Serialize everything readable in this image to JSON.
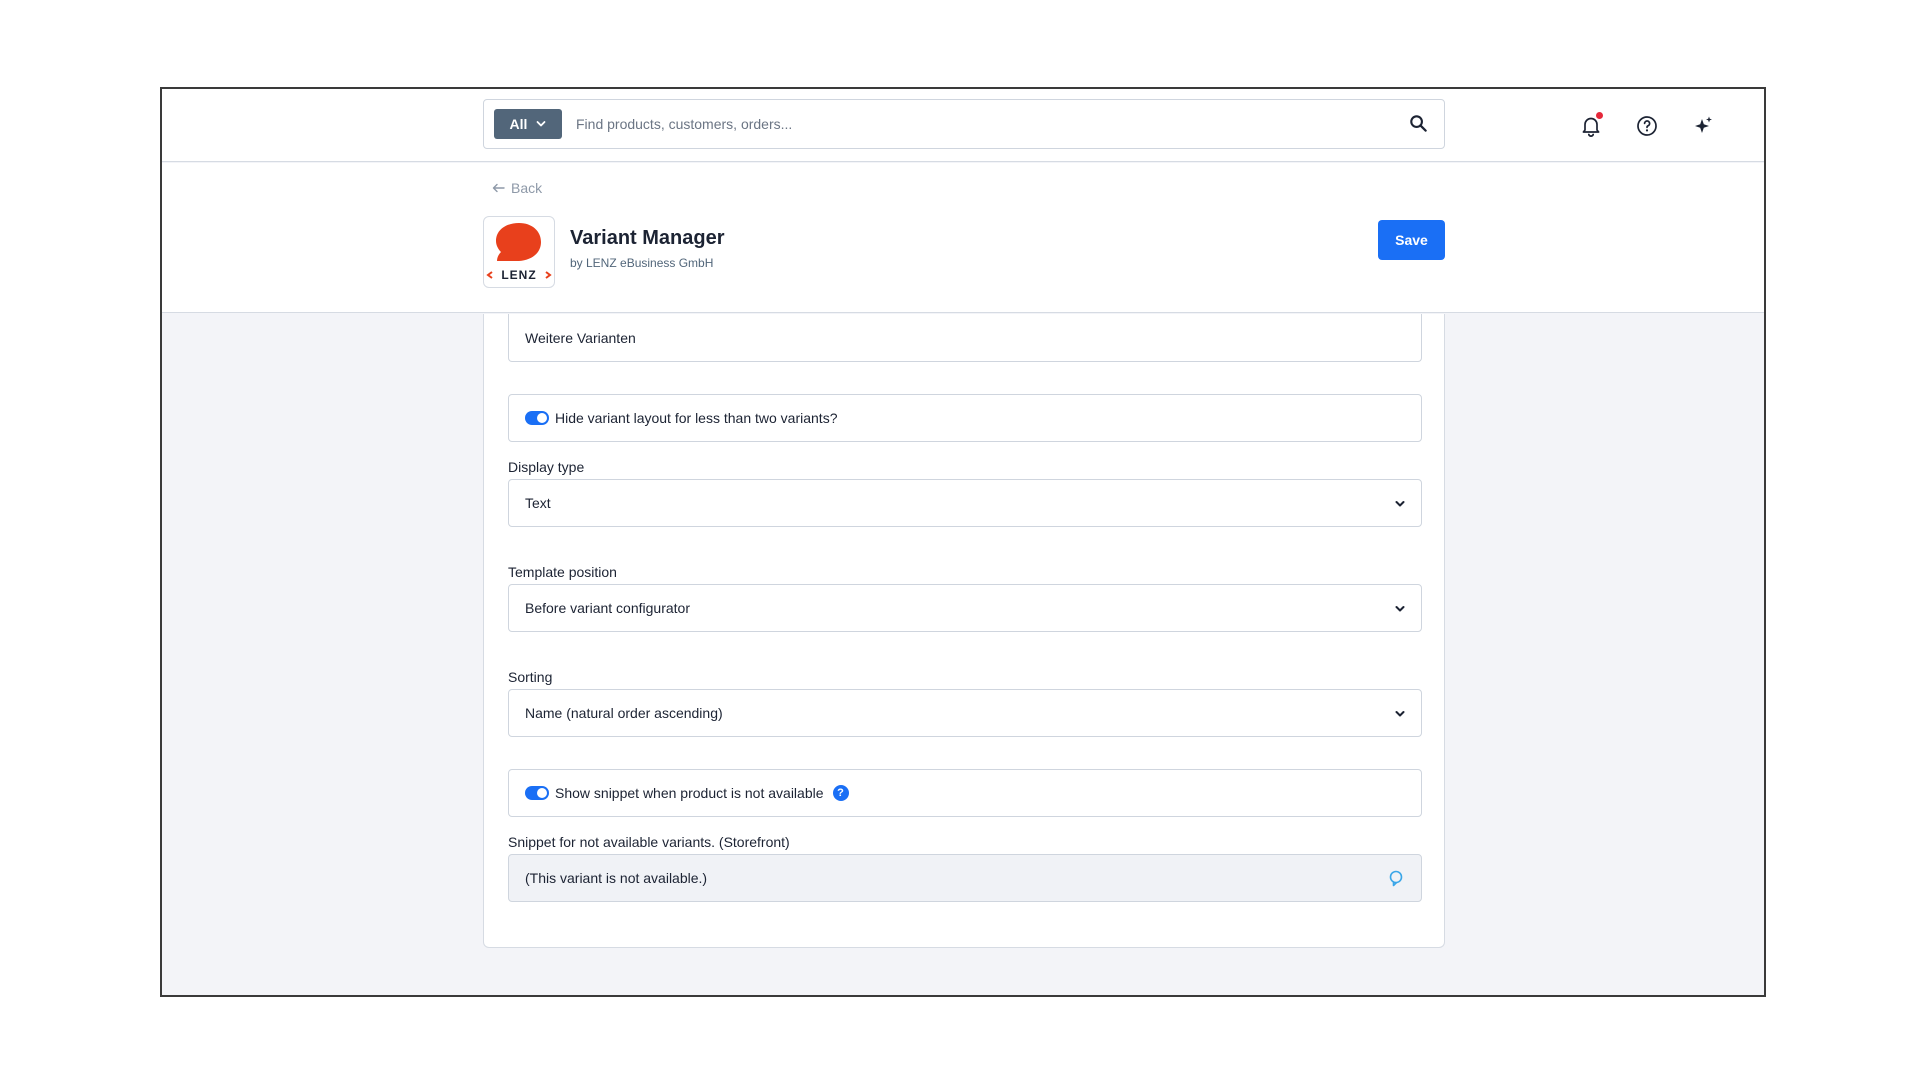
{
  "search": {
    "scope_label": "All",
    "placeholder": "Find products, customers, orders..."
  },
  "header": {
    "back_label": "Back",
    "app_title": "Variant Manager",
    "app_vendor": "by LENZ eBusiness GmbH",
    "logo_text": "LENZ",
    "save_label": "Save"
  },
  "form": {
    "additional_variants_value": "Weitere Varianten",
    "hide_layout_label": "Hide variant layout for less than two variants?",
    "hide_layout_enabled": true,
    "display_type": {
      "label": "Display type",
      "value": "Text"
    },
    "template_position": {
      "label": "Template position",
      "value": "Before variant configurator"
    },
    "sorting": {
      "label": "Sorting",
      "value": "Name (natural order ascending)"
    },
    "show_snippet_label": "Show snippet when product is not available",
    "show_snippet_enabled": true,
    "help_symbol": "?",
    "snippet": {
      "label": "Snippet for not available variants. (Storefront)",
      "value": "(This variant is not available.)"
    }
  },
  "colors": {
    "primary": "#1a6ff5",
    "scope_bg": "#52667a",
    "logo_red": "#e8401c",
    "notification_dot": "#e5283a"
  }
}
